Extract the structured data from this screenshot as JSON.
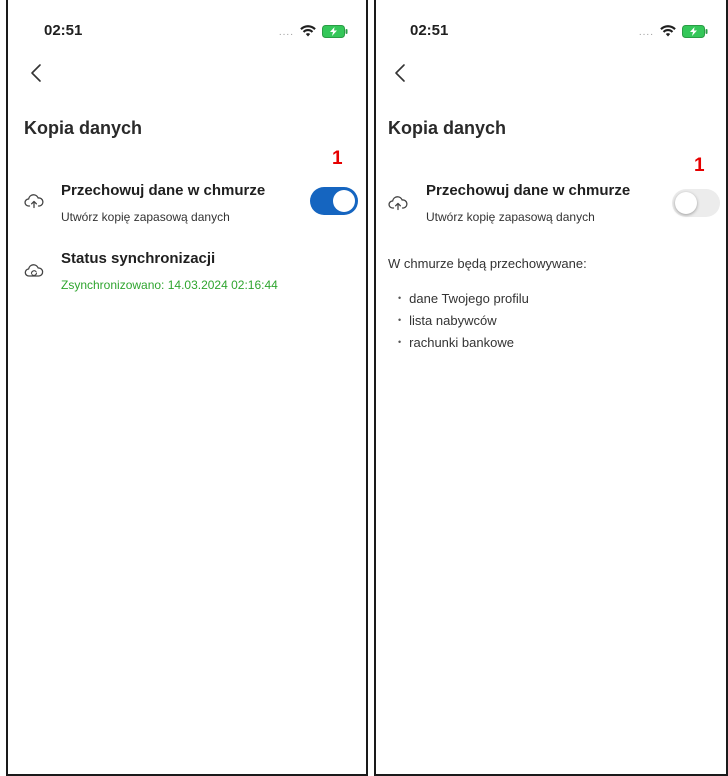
{
  "left_screen": {
    "status": {
      "time": "02:51",
      "signal": "....",
      "icons": [
        "signal-dots",
        "wifi-icon",
        "battery-charging-icon"
      ]
    },
    "back_icon": "chevron-left-icon",
    "title": "Kopia danych",
    "marker": "1",
    "cloud_row": {
      "icon": "cloud-upload-icon",
      "title": "Przechowuj dane w chmurze",
      "subtitle": "Utwórz kopię zapasową danych",
      "toggle": "on"
    },
    "sync_row": {
      "icon": "cloud-sync-icon",
      "title": "Status synchronizacji",
      "status": "Zsynchronizowano: 14.03.2024 02:16:44"
    }
  },
  "right_screen": {
    "status": {
      "time": "02:51",
      "signal": "....",
      "icons": [
        "signal-dots",
        "wifi-icon",
        "battery-charging-icon"
      ]
    },
    "back_icon": "chevron-left-icon",
    "title": "Kopia danych",
    "marker": "1",
    "cloud_row": {
      "icon": "cloud-upload-icon",
      "title": "Przechowuj dane w chmurze",
      "subtitle": "Utwórz kopię zapasową danych",
      "toggle": "off"
    },
    "info": "W chmurze będą przechowywane:",
    "items": [
      "dane Twojego profilu",
      "lista nabywców",
      "rachunki bankowe"
    ]
  },
  "colors": {
    "toggle_on": "#1565c0",
    "toggle_off": "#ececec",
    "sync_status": "#2fa52f",
    "marker": "#e60000",
    "battery": "#34c759"
  }
}
